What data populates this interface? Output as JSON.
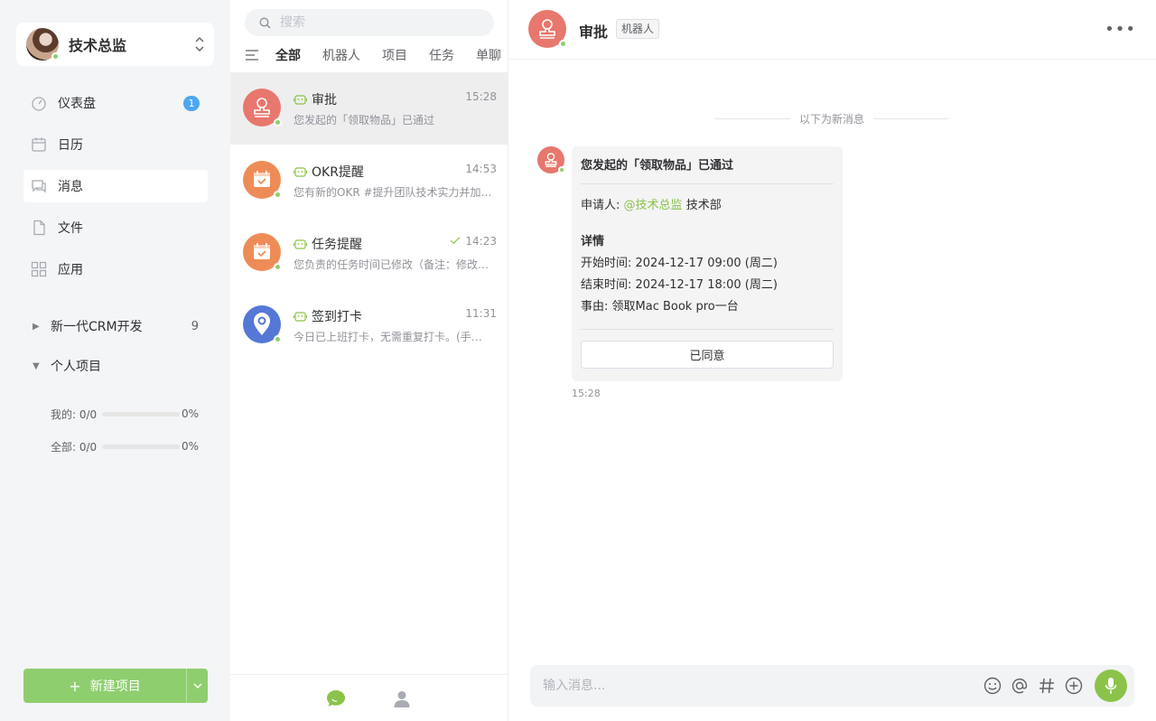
{
  "sidebar": {
    "user_name": "技术总监",
    "nav": [
      {
        "label": "仪表盘",
        "badge": "1"
      },
      {
        "label": "日历"
      },
      {
        "label": "消息"
      },
      {
        "label": "文件"
      },
      {
        "label": "应用"
      }
    ],
    "projects": [
      {
        "label": "新一代CRM开发",
        "count": "9",
        "expanded": false
      },
      {
        "label": "个人项目",
        "expanded": true
      }
    ],
    "progress": [
      {
        "label": "我的: 0/0",
        "percent": "0%",
        "value": 0
      },
      {
        "label": "全部: 0/0",
        "percent": "0%",
        "value": 0
      }
    ],
    "new_button": "新建项目"
  },
  "list": {
    "search_placeholder": "搜索",
    "tabs": [
      "全部",
      "机器人",
      "项目",
      "任务",
      "单聊"
    ],
    "conversations": [
      {
        "title": "审批",
        "time": "15:28",
        "preview": "您发起的「领取物品」已通过",
        "color": "#e8776d",
        "icon": "stamp-icon"
      },
      {
        "title": "OKR提醒",
        "time": "14:53",
        "preview": "您有新的OKR #提升团队技术实力并加快产品迭代",
        "color": "#ee8c57",
        "icon": "calendar-check-icon"
      },
      {
        "title": "任务提醒",
        "time": "14:23",
        "preview": "您负责的任务时间已修改（备注：修改任务时间）",
        "color": "#ee8c57",
        "icon": "calendar-check-icon"
      },
      {
        "title": "签到打卡",
        "time": "11:31",
        "preview": "今日已上班打卡，无需重复打卡。(手动打卡)",
        "color": "#5577d6",
        "icon": "location-pin-icon"
      }
    ]
  },
  "chat": {
    "title": "审批",
    "tag": "机器人",
    "divider": "以下为新消息",
    "card": {
      "title": "您发起的「领取物品」已通过",
      "applicant_label": "申请人:",
      "applicant_mention": "@技术总监",
      "applicant_dept": "技术部",
      "details_heading": "详情",
      "start": "开始时间: 2024-12-17 09:00 (周二)",
      "end": "结束时间: 2024-12-17 18:00 (周二)",
      "reason": "事由: 领取Mac Book pro一台",
      "button": "已同意"
    },
    "msg_time": "15:28",
    "input_placeholder": "输入消息..."
  },
  "colors": {
    "accent": "#8bc34a",
    "badge": "#4da6f0",
    "approval": "#e8776d"
  }
}
